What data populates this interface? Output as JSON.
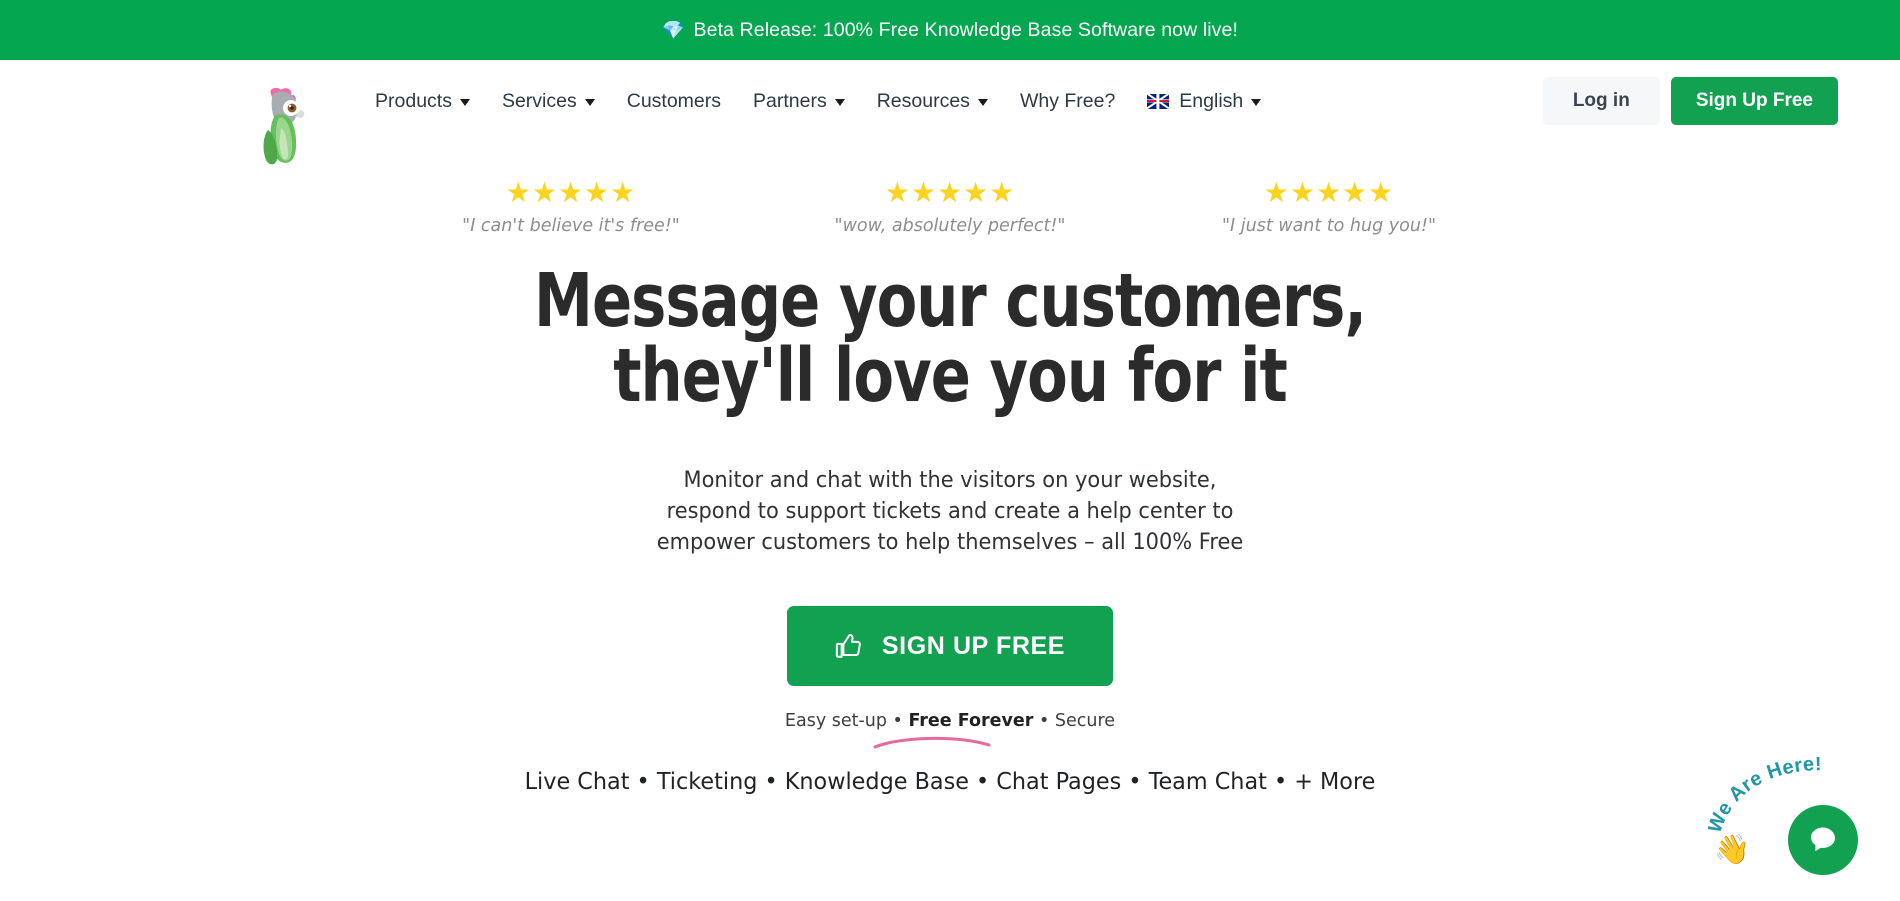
{
  "announcement": {
    "icon": "gem-icon",
    "text": "Beta Release: 100% Free Knowledge Base Software now live!",
    "background": "#04A64F"
  },
  "nav": {
    "logo_alt": "parrot-logo",
    "items": [
      {
        "label": "Products",
        "has_dropdown": true,
        "icon": null
      },
      {
        "label": "Services",
        "has_dropdown": true,
        "icon": null
      },
      {
        "label": "Customers",
        "has_dropdown": false,
        "icon": null
      },
      {
        "label": "Partners",
        "has_dropdown": true,
        "icon": null
      },
      {
        "label": "Resources",
        "has_dropdown": true,
        "icon": null
      },
      {
        "label": "Why Free?",
        "has_dropdown": false,
        "icon": null
      },
      {
        "label": "English",
        "has_dropdown": true,
        "icon": "uk-flag-icon"
      }
    ],
    "login_label": "Log in",
    "signup_label": "Sign Up Free"
  },
  "hero": {
    "testimonials": [
      {
        "stars": "★★★★★",
        "quote": "\"I can't believe it's free!\""
      },
      {
        "stars": "★★★★★",
        "quote": "\"wow, absolutely perfect!\""
      },
      {
        "stars": "★★★★★",
        "quote": "\"I just want to hug you!\""
      }
    ],
    "title_line1": "Message your customers,",
    "title_line2": "they'll love you for it",
    "sub_line1": "Monitor and chat with the visitors on your website,",
    "sub_line2": "respond to support tickets and create a help center to",
    "sub_line3": "empower customers to help themselves – all 100% Free",
    "cta_label": "SIGN UP FREE",
    "cta_icon": "thumbs-up-icon",
    "assurance_prefix": "Easy set-up • ",
    "assurance_bold": "Free Forever",
    "assurance_suffix": " • Secure",
    "features": "Live Chat • Ticketing • Knowledge Base • Chat Pages • Team Chat • + More"
  },
  "chat_widget": {
    "label": "We Are Here!",
    "hand_icon": "waving-hand-icon",
    "button_icon": "chat-bubble-icon",
    "label_color": "#2196a8",
    "button_color": "#12A150"
  },
  "colors": {
    "brand_green": "#12A150",
    "banner_green": "#04A64F",
    "star_yellow": "#FCD420",
    "heading_dark": "#2B2B2B",
    "quote_gray": "#8A8E93",
    "swoosh_pink": "#E8699B"
  }
}
